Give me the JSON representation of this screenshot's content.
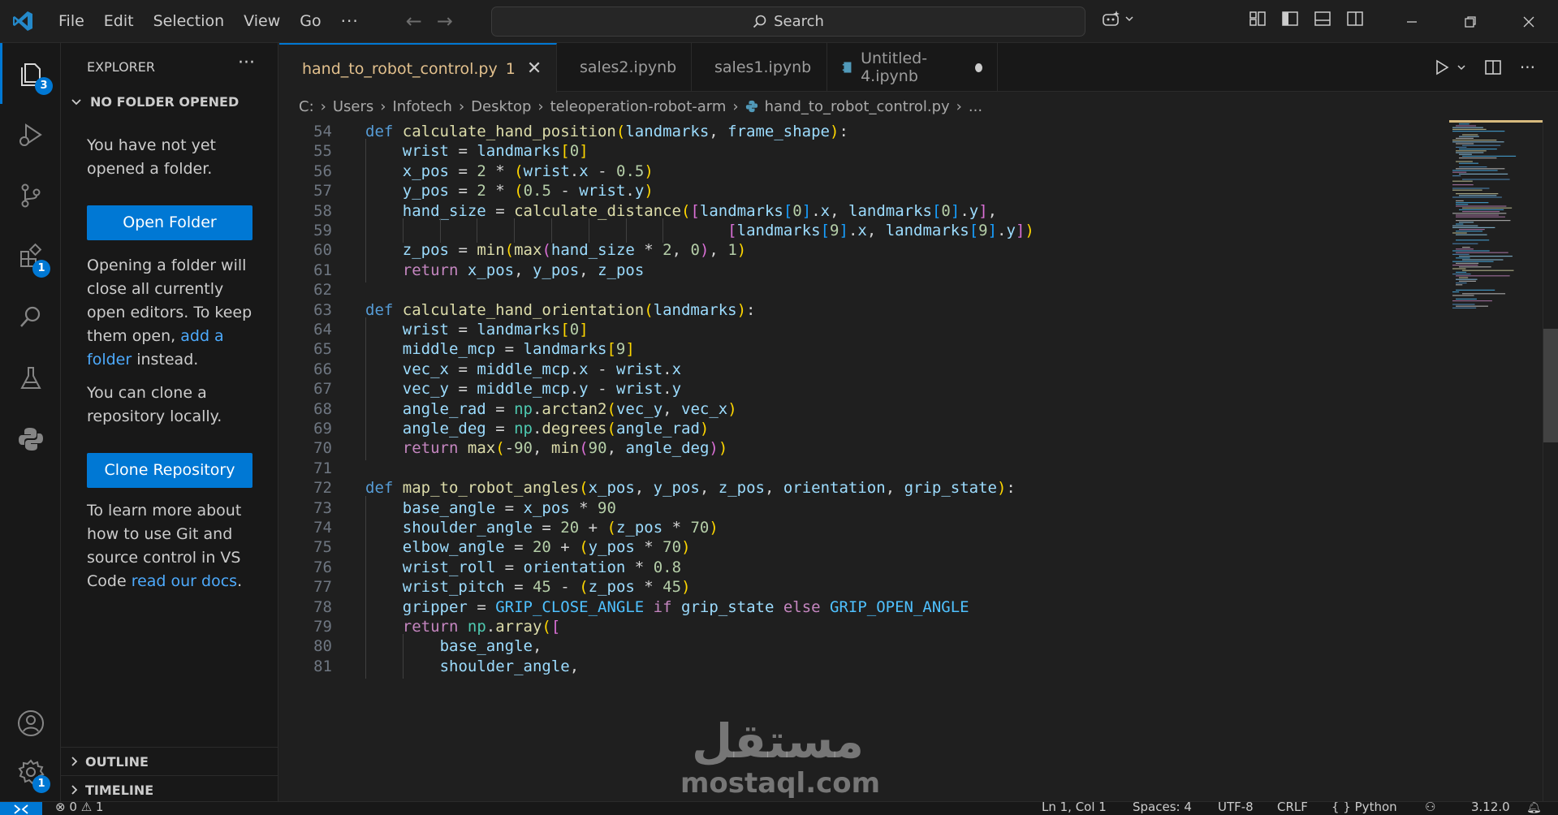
{
  "menu": {
    "file": "File",
    "edit": "Edit",
    "selection": "Selection",
    "view": "View",
    "go": "Go",
    "more": "···"
  },
  "search": {
    "label": "Search"
  },
  "badges": {
    "explorer": "3",
    "extensions": "1",
    "settings": "1"
  },
  "sidebar": {
    "title": "EXPLORER",
    "more": "···",
    "section": "NO FOLDER OPENED",
    "msg1": "You have not yet opened a folder.",
    "open_folder": "Open Folder",
    "msg2_part1": "Opening a folder will close all currently open editors. To keep them open, ",
    "msg2_link": "add a folder",
    "msg2_part2": " instead.",
    "msg3": "You can clone a repository locally.",
    "clone_repo": "Clone Repository",
    "msg4_part1": "To learn more about how to use Git and source control in VS Code ",
    "msg4_link": "read our docs",
    "msg4_part2": ".",
    "outline": "OUTLINE",
    "timeline": "TIMELINE"
  },
  "tabs": [
    {
      "label": "hand_to_robot_control.py",
      "problems": "1"
    },
    {
      "label": "sales2.ipynb"
    },
    {
      "label": "sales1.ipynb"
    },
    {
      "label": "Untitled-4.ipynb"
    }
  ],
  "breadcrumb": [
    "C:",
    "Users",
    "Infotech",
    "Desktop",
    "teleoperation-robot-arm",
    "hand_to_robot_control.py",
    "..."
  ],
  "code_lines": [
    {
      "n": "54",
      "tokens": [
        [
          "k",
          "def "
        ],
        [
          "f",
          "calculate_hand_position"
        ],
        [
          "b1",
          "("
        ],
        [
          "v",
          "landmarks"
        ],
        [
          "d",
          ", "
        ],
        [
          "v",
          "frame_shape"
        ],
        [
          "b1",
          ")"
        ],
        [
          "d",
          ":"
        ]
      ]
    },
    {
      "n": "55",
      "indent": 1,
      "tokens": [
        [
          "v",
          "wrist"
        ],
        [
          "d",
          " = "
        ],
        [
          "v",
          "landmarks"
        ],
        [
          "b1",
          "["
        ],
        [
          "n",
          "0"
        ],
        [
          "b1",
          "]"
        ]
      ]
    },
    {
      "n": "56",
      "indent": 1,
      "tokens": [
        [
          "v",
          "x_pos"
        ],
        [
          "d",
          " = "
        ],
        [
          "n",
          "2"
        ],
        [
          "d",
          " * "
        ],
        [
          "b1",
          "("
        ],
        [
          "v",
          "wrist"
        ],
        [
          "d",
          "."
        ],
        [
          "v",
          "x"
        ],
        [
          "d",
          " - "
        ],
        [
          "n",
          "0.5"
        ],
        [
          "b1",
          ")"
        ]
      ]
    },
    {
      "n": "57",
      "indent": 1,
      "tokens": [
        [
          "v",
          "y_pos"
        ],
        [
          "d",
          " = "
        ],
        [
          "n",
          "2"
        ],
        [
          "d",
          " * "
        ],
        [
          "b1",
          "("
        ],
        [
          "n",
          "0.5"
        ],
        [
          "d",
          " - "
        ],
        [
          "v",
          "wrist"
        ],
        [
          "d",
          "."
        ],
        [
          "v",
          "y"
        ],
        [
          "b1",
          ")"
        ]
      ]
    },
    {
      "n": "58",
      "indent": 1,
      "tokens": [
        [
          "v",
          "hand_size"
        ],
        [
          "d",
          " = "
        ],
        [
          "f",
          "calculate_distance"
        ],
        [
          "b1",
          "("
        ],
        [
          "b2",
          "["
        ],
        [
          "v",
          "landmarks"
        ],
        [
          "b3",
          "["
        ],
        [
          "n",
          "0"
        ],
        [
          "b3",
          "]"
        ],
        [
          "d",
          "."
        ],
        [
          "v",
          "x"
        ],
        [
          "d",
          ", "
        ],
        [
          "v",
          "landmarks"
        ],
        [
          "b3",
          "["
        ],
        [
          "n",
          "0"
        ],
        [
          "b3",
          "]"
        ],
        [
          "d",
          "."
        ],
        [
          "v",
          "y"
        ],
        [
          "b2",
          "]"
        ],
        [
          "d",
          ","
        ]
      ]
    },
    {
      "n": "59",
      "indent": 1,
      "guides": 9,
      "tokens": [
        [
          "d",
          "                                   "
        ],
        [
          "b2",
          "["
        ],
        [
          "v",
          "landmarks"
        ],
        [
          "b3",
          "["
        ],
        [
          "n",
          "9"
        ],
        [
          "b3",
          "]"
        ],
        [
          "d",
          "."
        ],
        [
          "v",
          "x"
        ],
        [
          "d",
          ", "
        ],
        [
          "v",
          "landmarks"
        ],
        [
          "b3",
          "["
        ],
        [
          "n",
          "9"
        ],
        [
          "b3",
          "]"
        ],
        [
          "d",
          "."
        ],
        [
          "v",
          "y"
        ],
        [
          "b2",
          "]"
        ],
        [
          "b1",
          ")"
        ]
      ]
    },
    {
      "n": "60",
      "indent": 1,
      "tokens": [
        [
          "v",
          "z_pos"
        ],
        [
          "d",
          " = "
        ],
        [
          "f",
          "min"
        ],
        [
          "b1",
          "("
        ],
        [
          "f",
          "max"
        ],
        [
          "b2",
          "("
        ],
        [
          "v",
          "hand_size"
        ],
        [
          "d",
          " * "
        ],
        [
          "n",
          "2"
        ],
        [
          "d",
          ", "
        ],
        [
          "n",
          "0"
        ],
        [
          "b2",
          ")"
        ],
        [
          "d",
          ", "
        ],
        [
          "n",
          "1"
        ],
        [
          "b1",
          ")"
        ]
      ]
    },
    {
      "n": "61",
      "indent": 1,
      "tokens": [
        [
          "kc",
          "return "
        ],
        [
          "v",
          "x_pos"
        ],
        [
          "d",
          ", "
        ],
        [
          "v",
          "y_pos"
        ],
        [
          "d",
          ", "
        ],
        [
          "v",
          "z_pos"
        ]
      ]
    },
    {
      "n": "62",
      "tokens": []
    },
    {
      "n": "63",
      "tokens": [
        [
          "k",
          "def "
        ],
        [
          "f",
          "calculate_hand_orientation"
        ],
        [
          "b1",
          "("
        ],
        [
          "v",
          "landmarks"
        ],
        [
          "b1",
          ")"
        ],
        [
          "d",
          ":"
        ]
      ]
    },
    {
      "n": "64",
      "indent": 1,
      "tokens": [
        [
          "v",
          "wrist"
        ],
        [
          "d",
          " = "
        ],
        [
          "v",
          "landmarks"
        ],
        [
          "b1",
          "["
        ],
        [
          "n",
          "0"
        ],
        [
          "b1",
          "]"
        ]
      ]
    },
    {
      "n": "65",
      "indent": 1,
      "tokens": [
        [
          "v",
          "middle_mcp"
        ],
        [
          "d",
          " = "
        ],
        [
          "v",
          "landmarks"
        ],
        [
          "b1",
          "["
        ],
        [
          "n",
          "9"
        ],
        [
          "b1",
          "]"
        ]
      ]
    },
    {
      "n": "66",
      "indent": 1,
      "tokens": [
        [
          "v",
          "vec_x"
        ],
        [
          "d",
          " = "
        ],
        [
          "v",
          "middle_mcp"
        ],
        [
          "d",
          "."
        ],
        [
          "v",
          "x"
        ],
        [
          "d",
          " - "
        ],
        [
          "v",
          "wrist"
        ],
        [
          "d",
          "."
        ],
        [
          "v",
          "x"
        ]
      ]
    },
    {
      "n": "67",
      "indent": 1,
      "tokens": [
        [
          "v",
          "vec_y"
        ],
        [
          "d",
          " = "
        ],
        [
          "v",
          "middle_mcp"
        ],
        [
          "d",
          "."
        ],
        [
          "v",
          "y"
        ],
        [
          "d",
          " - "
        ],
        [
          "v",
          "wrist"
        ],
        [
          "d",
          "."
        ],
        [
          "v",
          "y"
        ]
      ]
    },
    {
      "n": "68",
      "indent": 1,
      "tokens": [
        [
          "v",
          "angle_rad"
        ],
        [
          "d",
          " = "
        ],
        [
          "t",
          "np"
        ],
        [
          "d",
          "."
        ],
        [
          "f",
          "arctan2"
        ],
        [
          "b1",
          "("
        ],
        [
          "v",
          "vec_y"
        ],
        [
          "d",
          ", "
        ],
        [
          "v",
          "vec_x"
        ],
        [
          "b1",
          ")"
        ]
      ]
    },
    {
      "n": "69",
      "indent": 1,
      "tokens": [
        [
          "v",
          "angle_deg"
        ],
        [
          "d",
          " = "
        ],
        [
          "t",
          "np"
        ],
        [
          "d",
          "."
        ],
        [
          "f",
          "degrees"
        ],
        [
          "b1",
          "("
        ],
        [
          "v",
          "angle_rad"
        ],
        [
          "b1",
          ")"
        ]
      ]
    },
    {
      "n": "70",
      "indent": 1,
      "tokens": [
        [
          "kc",
          "return "
        ],
        [
          "f",
          "max"
        ],
        [
          "b1",
          "("
        ],
        [
          "d",
          "-"
        ],
        [
          "n",
          "90"
        ],
        [
          "d",
          ", "
        ],
        [
          "f",
          "min"
        ],
        [
          "b2",
          "("
        ],
        [
          "n",
          "90"
        ],
        [
          "d",
          ", "
        ],
        [
          "v",
          "angle_deg"
        ],
        [
          "b2",
          ")"
        ],
        [
          "b1",
          ")"
        ]
      ]
    },
    {
      "n": "71",
      "tokens": []
    },
    {
      "n": "72",
      "tokens": [
        [
          "k",
          "def "
        ],
        [
          "f",
          "map_to_robot_angles"
        ],
        [
          "b1",
          "("
        ],
        [
          "v",
          "x_pos"
        ],
        [
          "d",
          ", "
        ],
        [
          "v",
          "y_pos"
        ],
        [
          "d",
          ", "
        ],
        [
          "v",
          "z_pos"
        ],
        [
          "d",
          ", "
        ],
        [
          "v",
          "orientation"
        ],
        [
          "d",
          ", "
        ],
        [
          "v",
          "grip_state"
        ],
        [
          "b1",
          ")"
        ],
        [
          "d",
          ":"
        ]
      ]
    },
    {
      "n": "73",
      "indent": 1,
      "tokens": [
        [
          "v",
          "base_angle"
        ],
        [
          "d",
          " = "
        ],
        [
          "v",
          "x_pos"
        ],
        [
          "d",
          " * "
        ],
        [
          "n",
          "90"
        ]
      ]
    },
    {
      "n": "74",
      "indent": 1,
      "tokens": [
        [
          "v",
          "shoulder_angle"
        ],
        [
          "d",
          " = "
        ],
        [
          "n",
          "20"
        ],
        [
          "d",
          " + "
        ],
        [
          "b1",
          "("
        ],
        [
          "v",
          "z_pos"
        ],
        [
          "d",
          " * "
        ],
        [
          "n",
          "70"
        ],
        [
          "b1",
          ")"
        ]
      ]
    },
    {
      "n": "75",
      "indent": 1,
      "tokens": [
        [
          "v",
          "elbow_angle"
        ],
        [
          "d",
          " = "
        ],
        [
          "n",
          "20"
        ],
        [
          "d",
          " + "
        ],
        [
          "b1",
          "("
        ],
        [
          "v",
          "y_pos"
        ],
        [
          "d",
          " * "
        ],
        [
          "n",
          "70"
        ],
        [
          "b1",
          ")"
        ]
      ]
    },
    {
      "n": "76",
      "indent": 1,
      "tokens": [
        [
          "v",
          "wrist_roll"
        ],
        [
          "d",
          " = "
        ],
        [
          "v",
          "orientation"
        ],
        [
          "d",
          " * "
        ],
        [
          "n",
          "0.8"
        ]
      ]
    },
    {
      "n": "77",
      "indent": 1,
      "tokens": [
        [
          "v",
          "wrist_pitch"
        ],
        [
          "d",
          " = "
        ],
        [
          "n",
          "45"
        ],
        [
          "d",
          " - "
        ],
        [
          "b1",
          "("
        ],
        [
          "v",
          "z_pos"
        ],
        [
          "d",
          " * "
        ],
        [
          "n",
          "45"
        ],
        [
          "b1",
          ")"
        ]
      ]
    },
    {
      "n": "78",
      "indent": 1,
      "tokens": [
        [
          "v",
          "gripper"
        ],
        [
          "d",
          " = "
        ],
        [
          "c",
          "GRIP_CLOSE_ANGLE"
        ],
        [
          "kc",
          " if "
        ],
        [
          "v",
          "grip_state"
        ],
        [
          "kc",
          " else "
        ],
        [
          "c",
          "GRIP_OPEN_ANGLE"
        ]
      ]
    },
    {
      "n": "79",
      "indent": 1,
      "tokens": [
        [
          "kc",
          "return "
        ],
        [
          "t",
          "np"
        ],
        [
          "d",
          "."
        ],
        [
          "f",
          "array"
        ],
        [
          "b1",
          "("
        ],
        [
          "b2",
          "["
        ]
      ]
    },
    {
      "n": "80",
      "indent": 2,
      "tokens": [
        [
          "v",
          "base_angle"
        ],
        [
          "d",
          ","
        ]
      ]
    },
    {
      "n": "81",
      "indent": 2,
      "tokens": [
        [
          "v",
          "shoulder_angle"
        ],
        [
          "d",
          ","
        ]
      ]
    }
  ],
  "status": {
    "problems_errors": "0",
    "problems_warnings": "1",
    "position": "Ln 1, Col 1",
    "spaces": "Spaces: 4",
    "encoding": "UTF-8",
    "eol": "CRLF",
    "language": "Python",
    "version": "3.12.0"
  },
  "watermark": {
    "arabic": "مستقل",
    "latin": "mostaql.com"
  },
  "colors": {
    "accent": "#0078d4",
    "modified_tab": "#e2c08d",
    "link": "#4daafc"
  }
}
